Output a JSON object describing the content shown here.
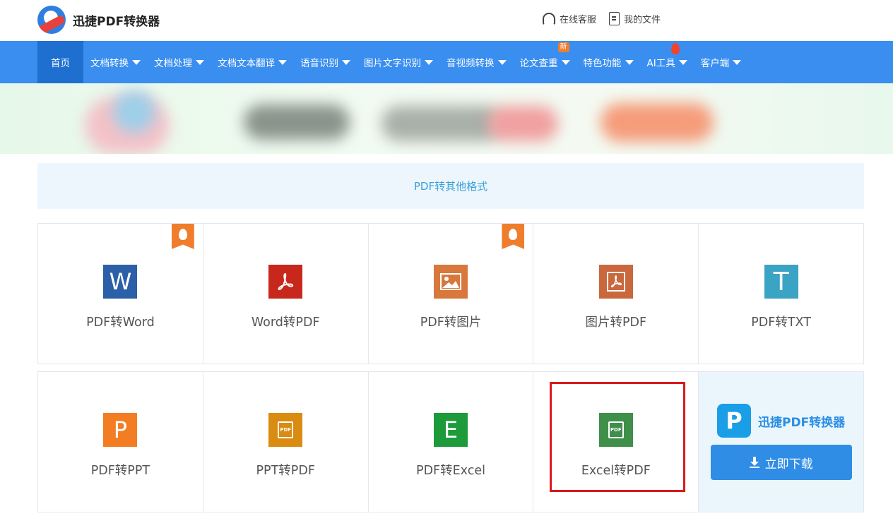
{
  "header": {
    "brand": "迅捷PDF转换器",
    "links": [
      {
        "label": "在线客服",
        "icon": "headset-icon"
      },
      {
        "label": "我的文件",
        "icon": "document-icon"
      }
    ]
  },
  "nav": {
    "items": [
      {
        "label": "首页"
      },
      {
        "label": "文档转换"
      },
      {
        "label": "文档处理"
      },
      {
        "label": "文档文本翻译"
      },
      {
        "label": "语音识别"
      },
      {
        "label": "图片文字识别"
      },
      {
        "label": "音视频转换"
      },
      {
        "label": "论文查重",
        "badge": "新"
      },
      {
        "label": "特色功能"
      },
      {
        "label": "AI工具"
      },
      {
        "label": "客户端"
      }
    ]
  },
  "section": {
    "title": "PDF转其他格式"
  },
  "tools_row1": [
    {
      "label": "PDF转Word",
      "glyph": "W",
      "color": "#2b5fa8",
      "hot": true
    },
    {
      "label": "Word转PDF",
      "glyph": "pdf",
      "color": "#c8281c",
      "hot": false
    },
    {
      "label": "PDF转图片",
      "glyph": "img",
      "color": "#d8783c",
      "hot": true
    },
    {
      "label": "图片转PDF",
      "glyph": "pdf",
      "color": "#c9673d",
      "hot": false
    },
    {
      "label": "PDF转TXT",
      "glyph": "T",
      "color": "#3ba3c4",
      "hot": false
    }
  ],
  "tools_row2": [
    {
      "label": "PDF转PPT",
      "glyph": "P",
      "color": "#f27d23"
    },
    {
      "label": "PPT转PDF",
      "glyph": "PDF",
      "color": "#d98b12"
    },
    {
      "label": "PDF转Excel",
      "glyph": "E",
      "color": "#1d9a3a"
    },
    {
      "label": "Excel转PDF",
      "glyph": "PDF",
      "color": "#3f8f4a"
    }
  ],
  "promo": {
    "logo_glyph": "P",
    "name": "迅捷PDF转换器",
    "download_label": "立即下载"
  }
}
